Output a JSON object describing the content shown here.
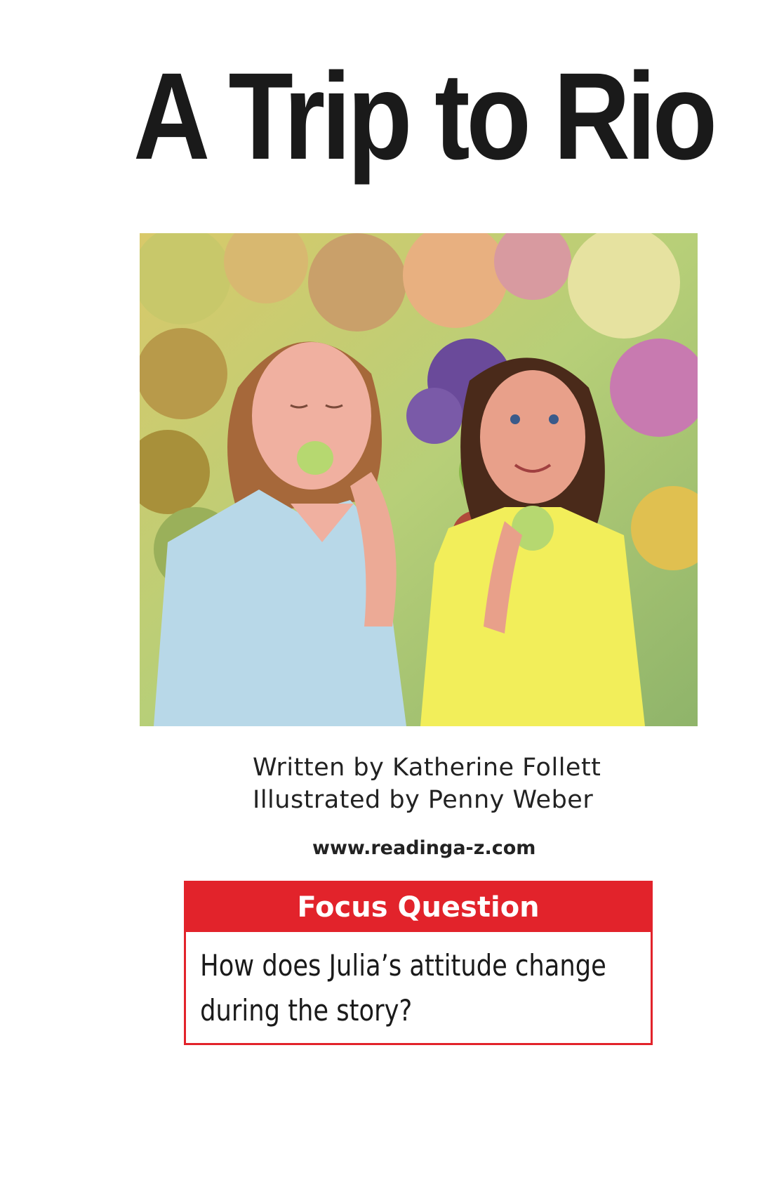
{
  "cover": {
    "title": "A Trip to Rio",
    "written_by": "Written by Katherine Follett",
    "illustrated_by": "Illustrated by Penny Weber",
    "website": "www.readinga-z.com"
  },
  "focus": {
    "heading": "Focus Question",
    "question": "How does Julia’s attitude change during the story?"
  },
  "colors": {
    "accent": "#e2232b",
    "title_text": "#1a1a1a"
  }
}
